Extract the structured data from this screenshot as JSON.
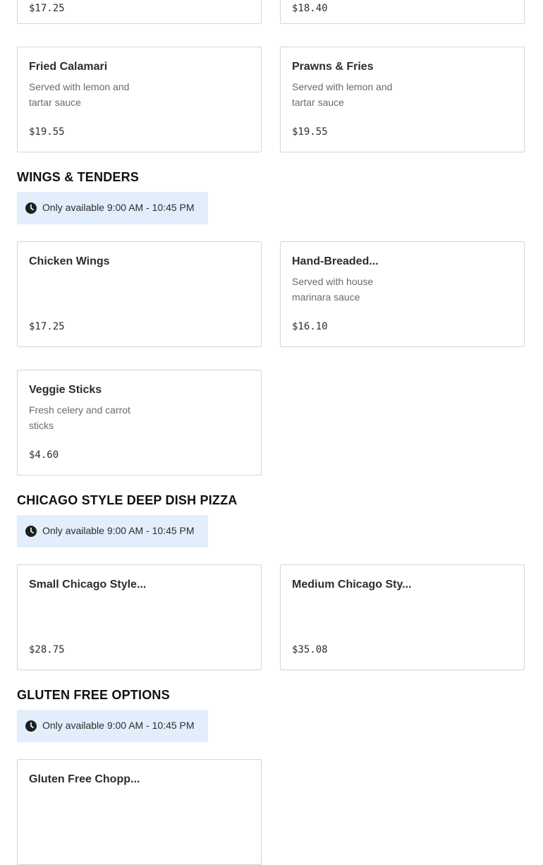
{
  "top_cards": [
    {
      "price": "$17.25"
    },
    {
      "price": "$18.40"
    }
  ],
  "seafood_cards": [
    {
      "name": "Fried Calamari",
      "description": "Served with lemon and tartar sauce",
      "price": "$19.55"
    },
    {
      "name": "Prawns & Fries",
      "description": "Served with lemon and tartar sauce",
      "price": "$19.55"
    }
  ],
  "sections": [
    {
      "title": "WINGS & TENDERS",
      "availability": "Only available 9:00 AM - 10:45 PM",
      "items": [
        {
          "name": "Chicken Wings",
          "description": "",
          "price": "$17.25"
        },
        {
          "name": "Hand-Breaded...",
          "description": "Served with house marinara sauce",
          "price": "$16.10"
        },
        {
          "name": "Veggie Sticks",
          "description": "Fresh celery and carrot sticks",
          "price": "$4.60"
        }
      ]
    },
    {
      "title": "CHICAGO STYLE DEEP DISH PIZZA",
      "availability": "Only available 9:00 AM - 10:45 PM",
      "items": [
        {
          "name": "Small Chicago Style...",
          "description": "",
          "price": "$28.75"
        },
        {
          "name": "Medium Chicago Sty...",
          "description": "",
          "price": "$35.08"
        }
      ]
    },
    {
      "title": "GLUTEN FREE OPTIONS",
      "availability": "Only available 9:00 AM - 10:45 PM",
      "items": [
        {
          "name": "Gluten Free Chopp..."
        }
      ]
    }
  ],
  "icons": {
    "availability": "clock-icon"
  },
  "colors": {
    "availability_bg": "#e2eefb",
    "card_border": "#d6d6d6",
    "heading": "#111111",
    "description": "#6b6b6b"
  }
}
